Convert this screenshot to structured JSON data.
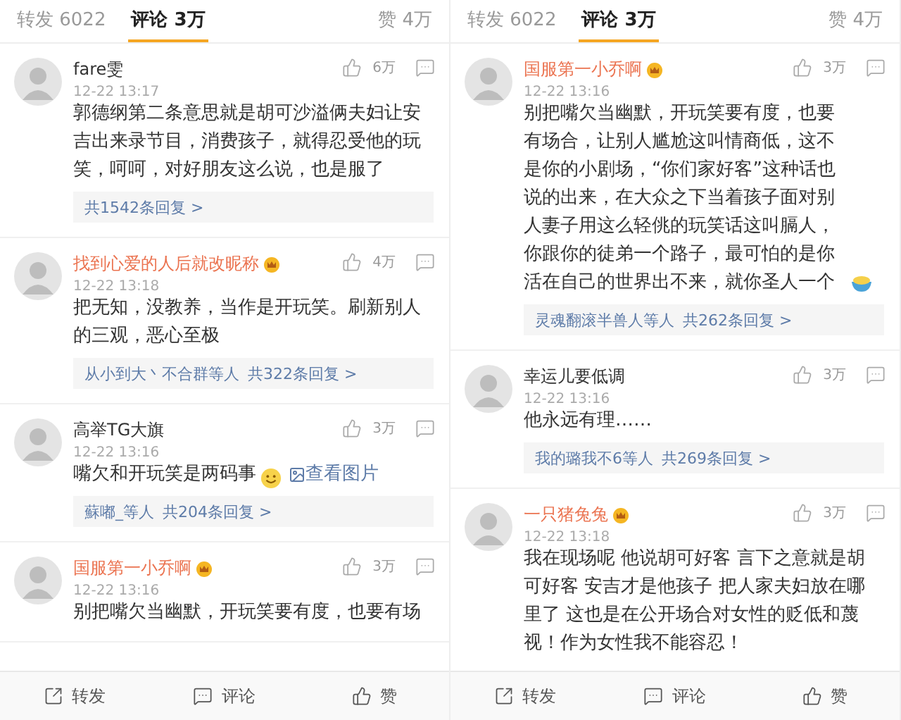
{
  "panels": [
    {
      "tabs": [
        {
          "label": "转发 6022",
          "selected": false
        },
        {
          "label": "评论 3万",
          "selected": true
        },
        {
          "label": "赞 4万",
          "selected": false
        }
      ],
      "comments": [
        {
          "name": "fare雯",
          "vip": false,
          "time": "12-22 13:17",
          "likes": "6万",
          "text": "郭德纲第二条意思就是胡可沙溢俩夫妇让安吉出来录节目，消费孩子，就得忍受他的玩笑，呵呵，对好朋友这么说，也是服了",
          "replies": "共1542条回复 >"
        },
        {
          "name": "找到心爱的人后就改昵称",
          "vip": true,
          "time": "12-22 13:18",
          "likes": "4万",
          "text": "把无知，没教养，当作是开玩笑。刷新别人的三观，恶心至极",
          "repliers": "从小到大丶不合群等人",
          "replies": "共322条回复 >"
        },
        {
          "name": "高举TG大旗",
          "vip": false,
          "time": "12-22 13:16",
          "likes": "3万",
          "text": "嘴欠和开玩笑是两码事",
          "emoji": {
            "kind": "smile"
          },
          "link": "查看图片",
          "repliers": "蘇嘟_等人",
          "replies": "共204条回复 >"
        },
        {
          "name": "国服第一小乔啊",
          "vip": true,
          "time": "12-22 13:16",
          "likes": "3万",
          "text": "别把嘴欠当幽默，开玩笑要有度，也要有场"
        }
      ],
      "actions": [
        "转发",
        "评论",
        "赞"
      ]
    },
    {
      "tabs": [
        {
          "label": "转发 6022",
          "selected": false
        },
        {
          "label": "评论 3万",
          "selected": true
        },
        {
          "label": "赞 4万",
          "selected": false
        }
      ],
      "comments": [
        {
          "name": "国服第一小乔啊",
          "vip": true,
          "time": "12-22 13:16",
          "likes": "3万",
          "text": "别把嘴欠当幽默，开玩笑要有度，也要有场合，让别人尴尬这叫情商低，这不是你的小剧场，“你们家好客”这种话也说的出来，在大众之下当着孩子面对别人妻子用这么轻佻的玩笑话这叫膈人，你跟你的徒弟一个路子，最可怕的是你活在自己的世界出不来，就你圣人一个",
          "emoji": {
            "kind": "bowl"
          },
          "repliers": "灵魂翻滚半兽人等人",
          "replies": "共262条回复 >"
        },
        {
          "name": "幸运儿要低调",
          "vip": false,
          "time": "12-22 13:16",
          "likes": "3万",
          "text": "他永远有理……",
          "repliers": "我的璐我不6等人",
          "replies": "共269条回复 >"
        },
        {
          "name": "一只猪兔兔",
          "vip": true,
          "time": "12-22 13:18",
          "likes": "3万",
          "text": "我在现场呢 他说胡可好客 言下之意就是胡可好客 安吉才是他孩子 把人家夫妇放在哪里了 这也是在公开场合对女性的贬低和蔑视！作为女性我不能容忍！"
        }
      ],
      "actions": [
        "转发",
        "评论",
        "赞"
      ]
    }
  ]
}
